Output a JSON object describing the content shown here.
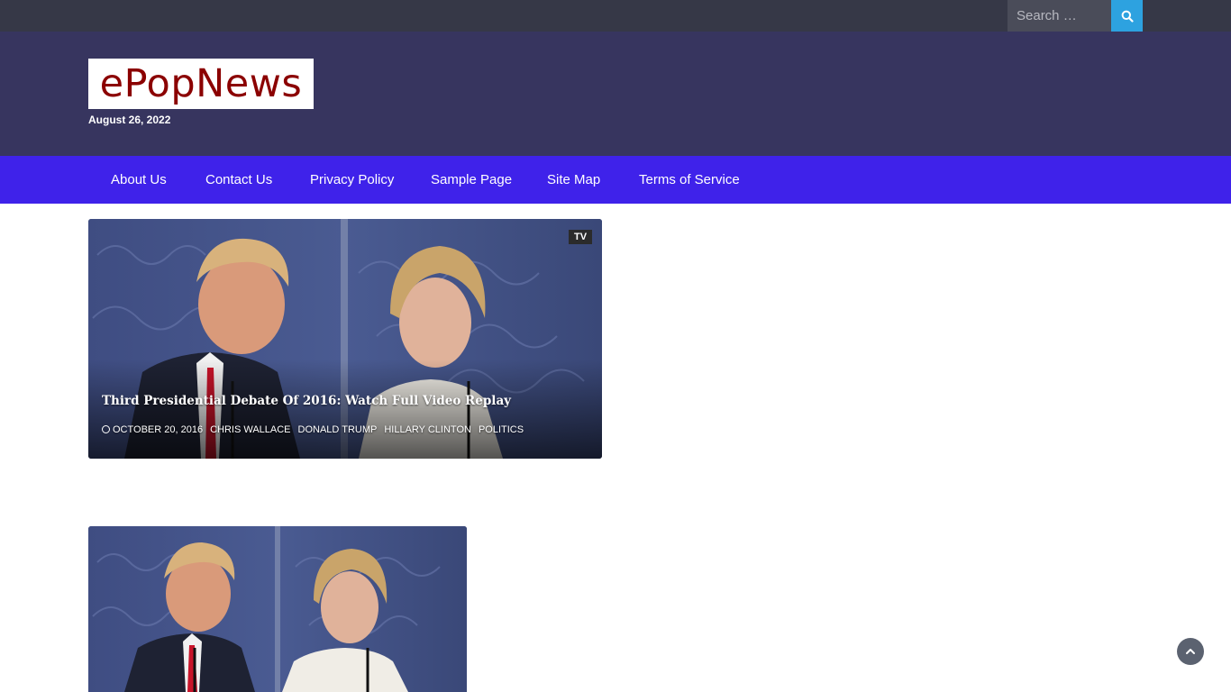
{
  "topbar": {
    "search": {
      "placeholder": "Search …",
      "value": ""
    },
    "search_button_icon": "search-icon"
  },
  "header": {
    "logo_text": "ePopNews",
    "date": "August 26, 2022"
  },
  "nav": {
    "items": [
      {
        "label": "About Us"
      },
      {
        "label": "Contact Us"
      },
      {
        "label": "Privacy Policy"
      },
      {
        "label": "Sample Page"
      },
      {
        "label": "Site Map"
      },
      {
        "label": "Terms of Service"
      }
    ]
  },
  "posts": [
    {
      "category": "TV",
      "title": "Third Presidential Debate Of 2016: Watch Full Video Replay",
      "date": "OCTOBER 20, 2016",
      "tags": [
        "CHRIS WALLACE",
        "DONALD TRUMP",
        "HILLARY CLINTON",
        "POLITICS"
      ]
    },
    {
      "category": "",
      "title": ""
    }
  ],
  "colors": {
    "topbar": "#363847",
    "header": "#37355f",
    "nav": "#3f22ea",
    "search_button": "#2da2e0",
    "logo_text": "#8b0000"
  },
  "scroll_top_icon": "chevron-up-icon"
}
